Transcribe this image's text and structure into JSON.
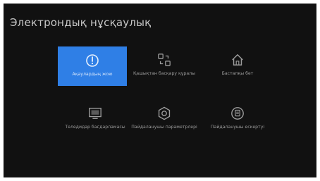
{
  "screen": {
    "title": "Электрондық нұсқаулық"
  },
  "tiles": [
    {
      "label": "Ақаулардың жою",
      "icon": "power-info-icon",
      "selected": true
    },
    {
      "label": "Қашықтан басқару құралы",
      "icon": "remote-control-icon",
      "selected": false
    },
    {
      "label": "Бастапқы бет",
      "icon": "home-icon",
      "selected": false
    },
    {
      "label": "Теледидар бағдарламасы",
      "icon": "tv-program-icon",
      "selected": false
    },
    {
      "label": "Пайдаланушы параметрлері",
      "icon": "settings-gear-icon",
      "selected": false
    },
    {
      "label": "Пайдаланушы ескертуі",
      "icon": "user-notice-icon",
      "selected": false
    }
  ],
  "colors": {
    "background": "#111111",
    "selected": "#2f7fe6",
    "text": "#9b9b9b",
    "icon": "#9e9e9e"
  }
}
